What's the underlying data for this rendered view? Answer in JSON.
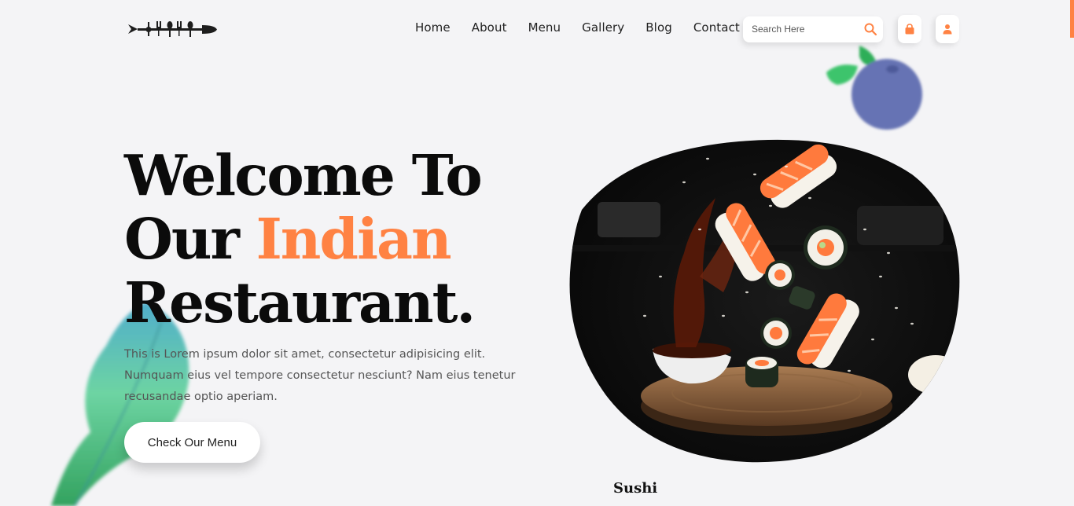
{
  "header": {
    "logo_icon": "cutlery-fish-logo-icon",
    "nav": [
      "Home",
      "About",
      "Menu",
      "Gallery",
      "Blog",
      "Contact"
    ],
    "search": {
      "placeholder": "Search Here",
      "icon": "search-icon"
    },
    "cart_icon": "shopping-bag-icon",
    "user_icon": "user-icon"
  },
  "hero": {
    "title_line1": "Welcome To",
    "title_line2_prefix": "Our ",
    "title_line2_accent": "Indian",
    "title_line3": "Restaurant.",
    "description": "This is Lorem ipsum dolor sit amet, consectetur adipisicing elit. Numquam eius vel tempore consectetur nesciunt? Nam eius tenetur recusandae optio aperiam.",
    "cta_label": "Check Our Menu"
  },
  "feature": {
    "caption": "Sushi",
    "image_icon": "sushi-image"
  },
  "colors": {
    "accent": "#ff8243",
    "background": "#f4f4f6",
    "text_dark": "#0b0b0b",
    "berry": "#6673b4",
    "leaf_green": "#3fba6a"
  }
}
